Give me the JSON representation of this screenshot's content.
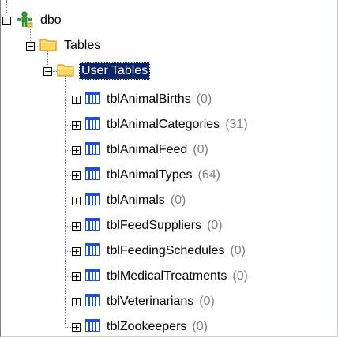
{
  "tree": {
    "root": {
      "label": "dbo",
      "icon": "schema-icon",
      "expanded": true
    },
    "tables": {
      "label": "Tables",
      "icon": "folder-icon",
      "expanded": true
    },
    "user_tables": {
      "label": "User Tables",
      "icon": "folder-icon",
      "expanded": true,
      "selected": true
    },
    "items": [
      {
        "name": "tblAnimalBirths",
        "count": "(0)"
      },
      {
        "name": "tblAnimalCategories",
        "count": "(31)"
      },
      {
        "name": "tblAnimalFeed",
        "count": "(0)"
      },
      {
        "name": "tblAnimalTypes",
        "count": "(64)"
      },
      {
        "name": "tblAnimals",
        "count": "(0)"
      },
      {
        "name": "tblFeedSuppliers",
        "count": "(0)"
      },
      {
        "name": "tblFeedingSchedules",
        "count": "(0)"
      },
      {
        "name": "tblMedicalTreatments",
        "count": "(0)"
      },
      {
        "name": "tblVeterinarians",
        "count": "(0)"
      },
      {
        "name": "tblZookeepers",
        "count": "(0)"
      }
    ]
  },
  "colors": {
    "selection_background": "#0a246a",
    "selection_text": "#ffffff",
    "count_text": "#808080",
    "folder_yellow": "#ffd75e",
    "table_icon_blue": "#1a4fd6",
    "schema_icon_green": "#2f9e2f"
  }
}
